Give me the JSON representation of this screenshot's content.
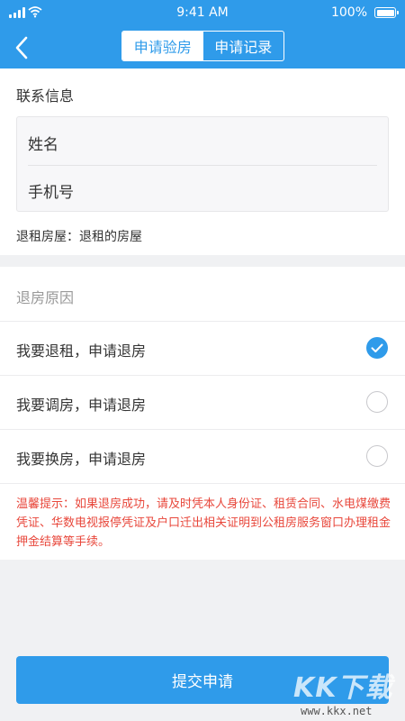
{
  "status_bar": {
    "time": "9:41 AM",
    "battery": "100%"
  },
  "nav": {
    "tabs": [
      {
        "label": "申请验房",
        "active": true
      },
      {
        "label": "申请记录",
        "active": false
      }
    ]
  },
  "contact": {
    "title": "联系信息",
    "name_placeholder": "姓名",
    "phone_placeholder": "手机号",
    "house_text": "退租房屋：退租的房屋"
  },
  "reason": {
    "title": "退房原因",
    "options": [
      {
        "label": "我要退租，申请退房",
        "checked": true
      },
      {
        "label": "我要调房，申请退房",
        "checked": false
      },
      {
        "label": "我要换房，申请退房",
        "checked": false
      }
    ],
    "tip": "温馨提示：如果退房成功，请及时凭本人身份证、租赁合同、水电煤缴费凭证、华数电视报停凭证及户口迁出相关证明到公租房服务窗口办理租金押金结算等手续。"
  },
  "submit_label": "提交申请",
  "watermark": {
    "brand": "KK下载",
    "url": "www.kkx.net"
  },
  "colors": {
    "primary": "#2f9bea",
    "tip": "#e8473b"
  }
}
